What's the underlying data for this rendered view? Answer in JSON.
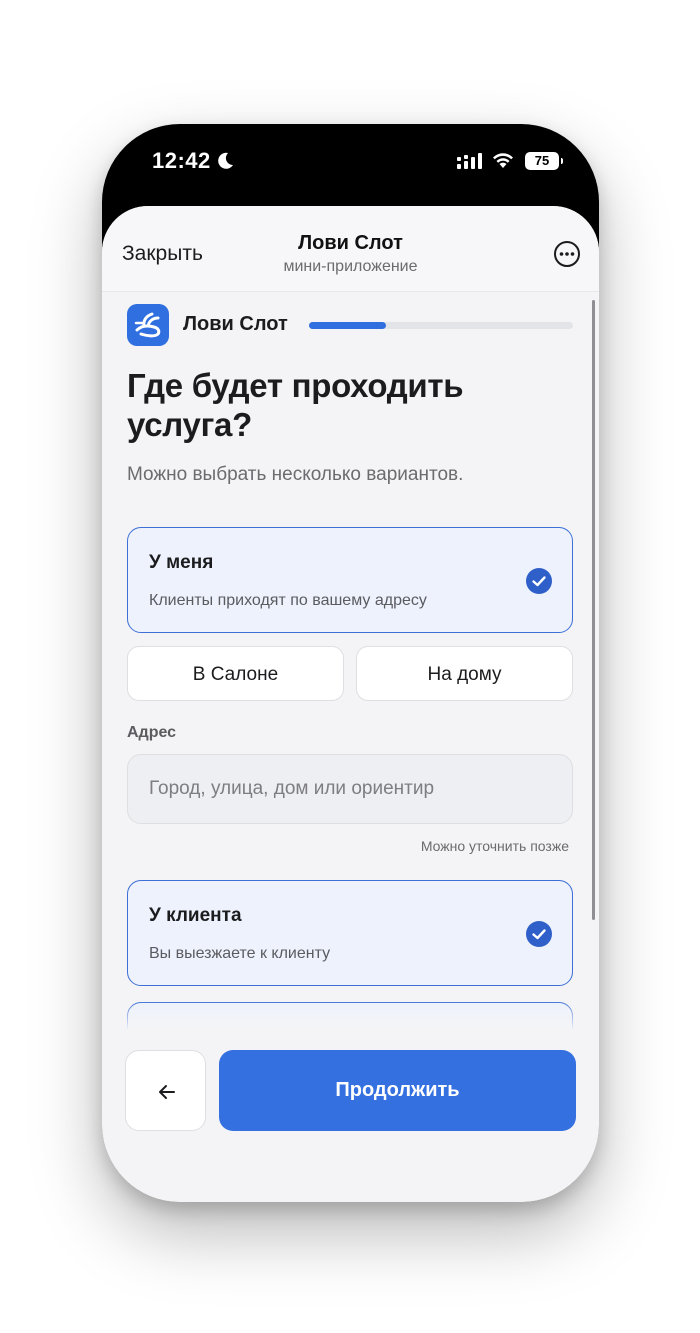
{
  "status_bar": {
    "time": "12:42",
    "battery": "75",
    "icons": [
      "moon-icon",
      "cellular-signal-icon",
      "wifi-icon",
      "battery-icon"
    ]
  },
  "nav": {
    "close_label": "Закрыть",
    "title": "Лови Слот",
    "subtitle": "мини-приложение",
    "more_icon": "ellipsis-circle-icon"
  },
  "brand": {
    "name": "Лови Слот",
    "progress_fraction": 0.29
  },
  "question": {
    "title": "Где будет проходить услуга?",
    "subtitle": "Можно выбрать несколько вариантов."
  },
  "options": [
    {
      "title": "У меня",
      "description": "Клиенты приходят по вашему адресу",
      "selected": true
    },
    {
      "title": "У клиента",
      "description": "Вы выезжаете к клиенту",
      "selected": true
    }
  ],
  "place_types": [
    {
      "label": "В Салоне"
    },
    {
      "label": "На дому"
    }
  ],
  "address": {
    "label": "Адрес",
    "placeholder": "Город, улица, дом или ориентир",
    "value": "",
    "hint": "Можно уточнить позже"
  },
  "footer": {
    "back_icon": "arrow-left-icon",
    "continue_label": "Продолжить"
  },
  "colors": {
    "accent": "#3470e0",
    "selected_border": "#3d6fd6",
    "selected_bg": "#edf2fc",
    "background": "#f4f4f6"
  }
}
